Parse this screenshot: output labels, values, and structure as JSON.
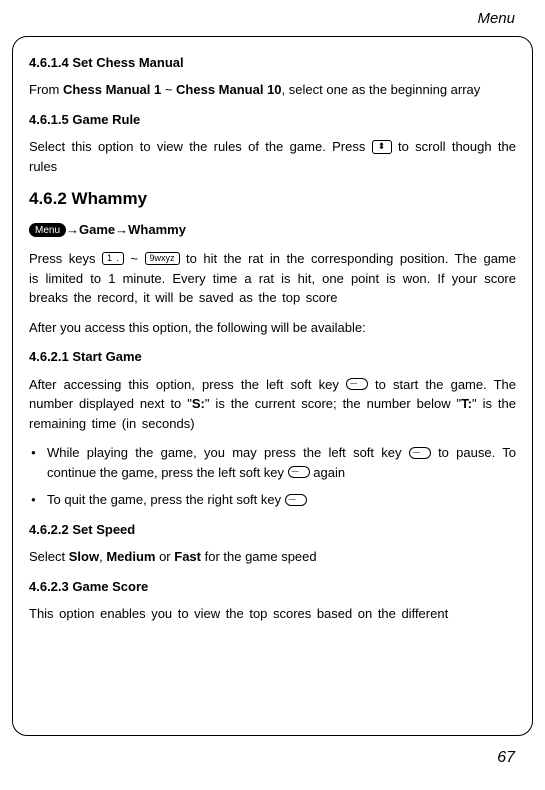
{
  "header": {
    "title": "Menu"
  },
  "sections": {
    "s4614_title": "4.6.1.4 Set Chess Manual",
    "s4614_p1_a": "From ",
    "s4614_p1_b1": "Chess Manual 1",
    "s4614_p1_mid": " ~ ",
    "s4614_p1_b2": "Chess Manual 10",
    "s4614_p1_c": ", select one as the beginning array",
    "s4615_title": "4.6.1.5 Game Rule",
    "s4615_p1_a": "Select this option to view the rules of the game. Press ",
    "s4615_p1_b": " to scroll though the rules",
    "s462_title": "4.6.2 Whammy",
    "breadcrumb_menu": "Menu",
    "breadcrumb_game": "Game",
    "breadcrumb_whammy": "Whammy",
    "arrow": "→",
    "s462_p1_a": "Press keys ",
    "s462_key1": "1 .",
    "s462_tilde": " ~ ",
    "s462_key9": "9wxyz",
    "s462_p1_b": " to hit the rat in the corresponding position. The game is limited to 1 minute. Every time a rat is hit, one point is won. If your score breaks the record, it will be saved as the top score",
    "s462_p2": "After you access this option, the following will be available:",
    "s4621_title": "4.6.2.1 Start Game",
    "s4621_p1_a": "After accessing this option, press the left soft key ",
    "s4621_p1_b": " to start the game. The number displayed next to \"",
    "s4621_S": "S:",
    "s4621_p1_c": "\" is the current score; the number below \"",
    "s4621_T": "T:",
    "s4621_p1_d": "\" is the remaining time (in seconds)",
    "bullet1_a": "While playing the game, you may press the left soft key ",
    "bullet1_b": " to pause. To continue the game, press the left soft key ",
    "bullet1_c": " again",
    "bullet2_a": "To quit the game, press the right soft key ",
    "s4622_title": "4.6.2.2 Set Speed",
    "s4622_p1_a": "Select ",
    "s4622_slow": "Slow",
    "s4622_p1_b": ", ",
    "s4622_medium": "Medium",
    "s4622_p1_c": " or ",
    "s4622_fast": "Fast",
    "s4622_p1_d": " for the game speed",
    "s4623_title": "4.6.2.3 Game Score",
    "s4623_p1": "This option enables you to view the top scores based on the different"
  },
  "page_number": "67"
}
